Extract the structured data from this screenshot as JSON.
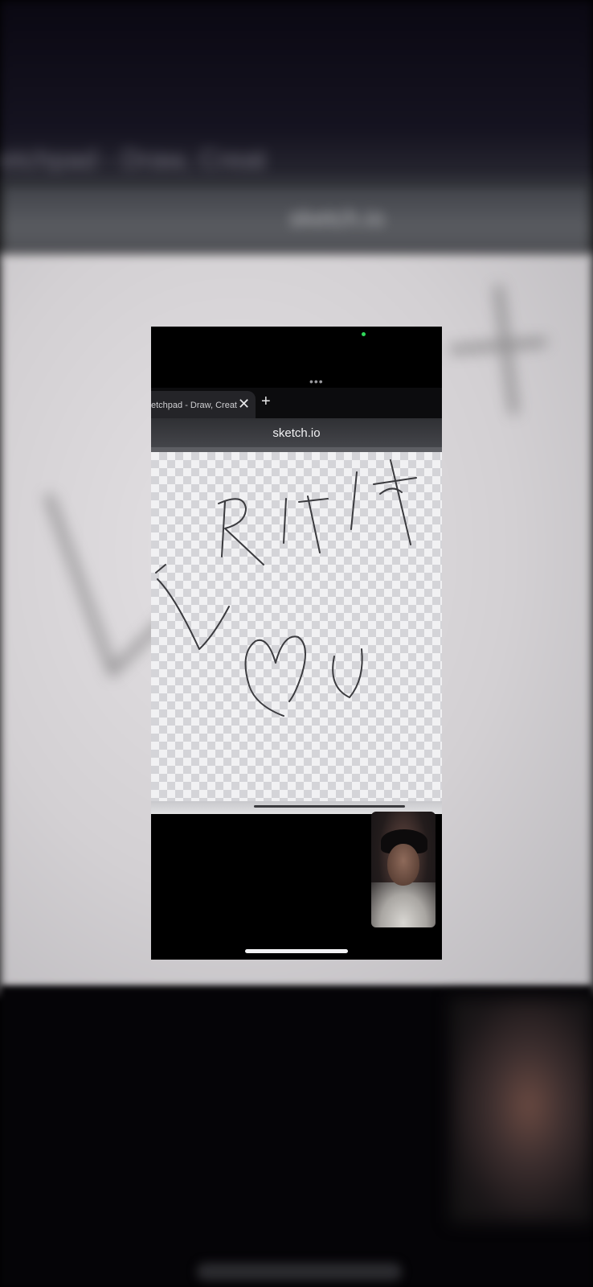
{
  "browser": {
    "tab_title": "etchpad - Draw, Creat",
    "tab_close_symbol": "✕",
    "new_tab_symbol": "+",
    "url": "sketch.io",
    "menu_dots": "•••"
  },
  "colors": {
    "camera_indicator": "#2fd85a",
    "ink": "#3a3a3e",
    "background": "#000000"
  },
  "icons": [
    "close-icon",
    "plus-icon",
    "more-dots-icon",
    "camera-indicator-icon"
  ]
}
